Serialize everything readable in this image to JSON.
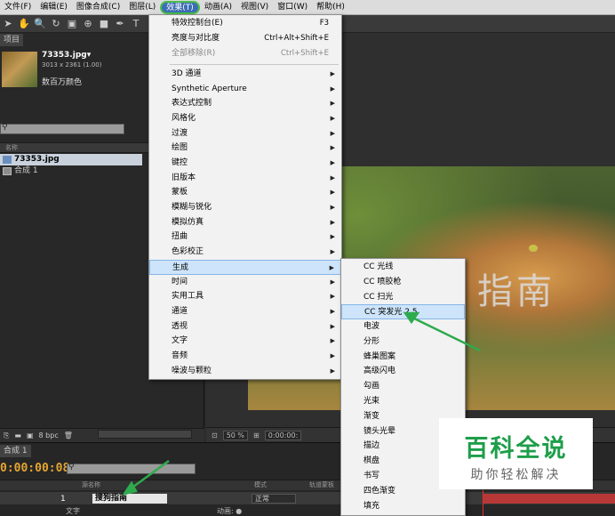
{
  "menubar": {
    "items": [
      {
        "label": "文件(F)"
      },
      {
        "label": "编辑(E)"
      },
      {
        "label": "图像合成(C)"
      },
      {
        "label": "图层(L)"
      },
      {
        "label": "效果(T)",
        "active": true
      },
      {
        "label": "动画(A)"
      },
      {
        "label": "视图(V)"
      },
      {
        "label": "窗口(W)"
      },
      {
        "label": "帮助(H)"
      }
    ]
  },
  "project": {
    "tab": "项目",
    "file_name": "73353.jpg▾",
    "file_size": "3013 x 2361 (1.00)",
    "color_info": "数百万颜色",
    "col_name": "名称",
    "items": [
      {
        "label": "73353.jpg"
      },
      {
        "label": "合成 1"
      }
    ],
    "bpc": "8 bpc"
  },
  "viewer": {
    "overlay_text": "指南",
    "zoom": "50 %",
    "timecode": "0:00:00:"
  },
  "timeline": {
    "tab": "合成 1",
    "time": "0:00:00:08",
    "col_source": "源名称",
    "col_mode": "模式",
    "col_trkmat": "轨道蒙板",
    "layer_num": "1",
    "layer_name": "搜狗指南",
    "layer_mode": "正常",
    "sub_text": "文字",
    "sub_anim": "动画: ●"
  },
  "effect_menu": {
    "items": [
      {
        "label": "特效控制台(E)",
        "shortcut": "F3"
      },
      {
        "label": "亮度与对比度",
        "shortcut": "Ctrl+Alt+Shift+E"
      },
      {
        "label": "全部移除(R)",
        "shortcut": "Ctrl+Shift+E",
        "disabled": true
      },
      {
        "label": "3D 通道"
      },
      {
        "label": "Synthetic Aperture"
      },
      {
        "label": "表达式控制"
      },
      {
        "label": "风格化"
      },
      {
        "label": "过渡"
      },
      {
        "label": "绘图"
      },
      {
        "label": "键控"
      },
      {
        "label": "旧版本"
      },
      {
        "label": "蒙板"
      },
      {
        "label": "模糊与锐化"
      },
      {
        "label": "模拟仿真"
      },
      {
        "label": "扭曲"
      },
      {
        "label": "色彩校正"
      },
      {
        "label": "生成",
        "highlighted": true
      },
      {
        "label": "时间"
      },
      {
        "label": "实用工具"
      },
      {
        "label": "通道"
      },
      {
        "label": "透视"
      },
      {
        "label": "文字"
      },
      {
        "label": "音频"
      },
      {
        "label": "噪波与颗粒"
      }
    ]
  },
  "sub_menu": {
    "items": [
      {
        "label": "CC 光线"
      },
      {
        "label": "CC 喷胶枪"
      },
      {
        "label": "CC 扫光"
      },
      {
        "label": "CC 突发光 2.5",
        "highlighted": true
      },
      {
        "label": "电波"
      },
      {
        "label": "分形"
      },
      {
        "label": "蜂巢图案"
      },
      {
        "label": "高级闪电"
      },
      {
        "label": "勾画"
      },
      {
        "label": "光束"
      },
      {
        "label": "渐变"
      },
      {
        "label": "镜头光晕"
      },
      {
        "label": "描边"
      },
      {
        "label": "棋盘"
      },
      {
        "label": "书写"
      },
      {
        "label": "四色渐变"
      },
      {
        "label": "填充"
      }
    ]
  },
  "watermark": {
    "title": "百科全说",
    "subtitle": "助你轻松解决"
  },
  "colors": {
    "highlight": "#cde4fa",
    "annotation": "#2faa4e",
    "timecode": "#e6a531",
    "layer_bar": "#b83737"
  }
}
